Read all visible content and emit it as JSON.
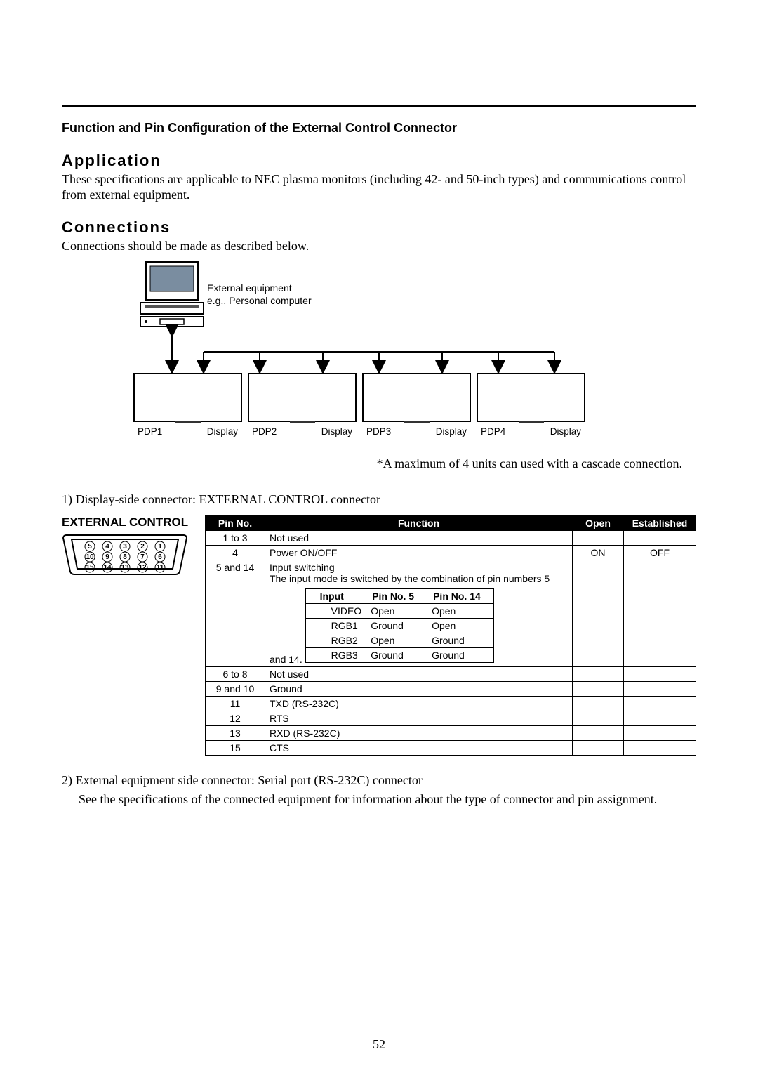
{
  "heading": "Function and Pin Configuration of the External Control Connector",
  "application": {
    "title": "Application",
    "body": "These specifications are applicable to NEC plasma monitors (including 42- and 50-inch types) and communications control from external equipment."
  },
  "connections": {
    "title": "Connections",
    "intro": "Connections should be made as described below.",
    "ext_equip_1": "External equipment",
    "ext_equip_2": "e.g., Personal computer",
    "pdp": [
      {
        "id": "PDP1",
        "label": "Display"
      },
      {
        "id": "PDP2",
        "label": "Display"
      },
      {
        "id": "PDP3",
        "label": "Display"
      },
      {
        "id": "PDP4",
        "label": "Display"
      }
    ],
    "cascade_note": "*A maximum of 4 units can used with a cascade connection.",
    "item1": "1)  Display-side connector: EXTERNAL CONTROL connector",
    "connector_label": "EXTERNAL CONTROL",
    "item2_a": "2)  External equipment side connector: Serial port (RS-232C) connector",
    "item2_b": "See the specifications of the connected equipment for information about the type of connector and pin assignment."
  },
  "table": {
    "headers": {
      "pin": "Pin No.",
      "func": "Function",
      "open": "Open",
      "est": "Established"
    },
    "rows": [
      {
        "pin": "1 to 3",
        "func": "Not used",
        "open": "",
        "est": ""
      },
      {
        "pin": "4",
        "func": "Power ON/OFF",
        "open": "ON",
        "est": "OFF"
      },
      {
        "pin": "5 and 14",
        "func_intro1": "Input switching",
        "func_intro2": "The input mode is switched by the combination of pin numbers 5 and 14.",
        "open": "",
        "est": ""
      },
      {
        "pin": "6 to 8",
        "func": "Not used",
        "open": "",
        "est": ""
      },
      {
        "pin": "9 and 10",
        "func": "Ground",
        "open": "",
        "est": ""
      },
      {
        "pin": "11",
        "func": "TXD (RS-232C)",
        "open": "",
        "est": ""
      },
      {
        "pin": "12",
        "func": "RTS",
        "open": "",
        "est": ""
      },
      {
        "pin": "13",
        "func": "RXD (RS-232C)",
        "open": "",
        "est": ""
      },
      {
        "pin": "15",
        "func": "CTS",
        "open": "",
        "est": ""
      }
    ],
    "inner": {
      "headers": {
        "input": "Input",
        "p5": "Pin No. 5",
        "p14": "Pin No. 14"
      },
      "rows": [
        {
          "input": "VIDEO",
          "p5": "Open",
          "p14": "Open"
        },
        {
          "input": "RGB1",
          "p5": "Ground",
          "p14": "Open"
        },
        {
          "input": "RGB2",
          "p5": "Open",
          "p14": "Ground"
        },
        {
          "input": "RGB3",
          "p5": "Ground",
          "p14": "Ground"
        }
      ]
    }
  },
  "page": "52"
}
